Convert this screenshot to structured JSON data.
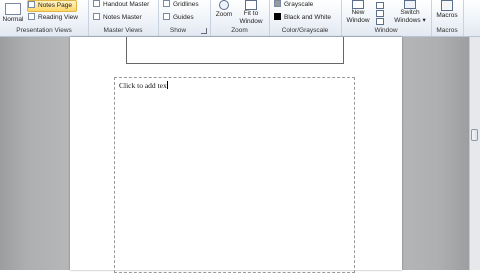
{
  "ribbon": {
    "presentation_views": {
      "label": "Presentation Views",
      "normal": "Normal",
      "notes_page": "Notes Page",
      "reading_view": "Reading View"
    },
    "master_views": {
      "label": "Master Views",
      "handout_master": "Handout Master",
      "notes_master": "Notes Master"
    },
    "show": {
      "label": "Show",
      "gridlines": "Gridlines",
      "guides": "Guides"
    },
    "zoom": {
      "label": "Zoom",
      "zoom": "Zoom",
      "fit_to_window_line1": "Fit to",
      "fit_to_window_line2": "Window"
    },
    "color_grayscale": {
      "label": "Color/Grayscale",
      "grayscale": "Grayscale",
      "black_and_white": "Black and White"
    },
    "window": {
      "label": "Window",
      "new_window_line1": "New",
      "new_window_line2": "Window",
      "switch_windows_line1": "Switch",
      "switch_windows_line2": "Windows"
    },
    "macros": {
      "label": "Macros",
      "macros": "Macros"
    }
  },
  "document": {
    "notes_placeholder": "Click to add tex"
  },
  "colors": {
    "accent_highlight": "#ffd86b",
    "workspace": "#a9abad"
  }
}
